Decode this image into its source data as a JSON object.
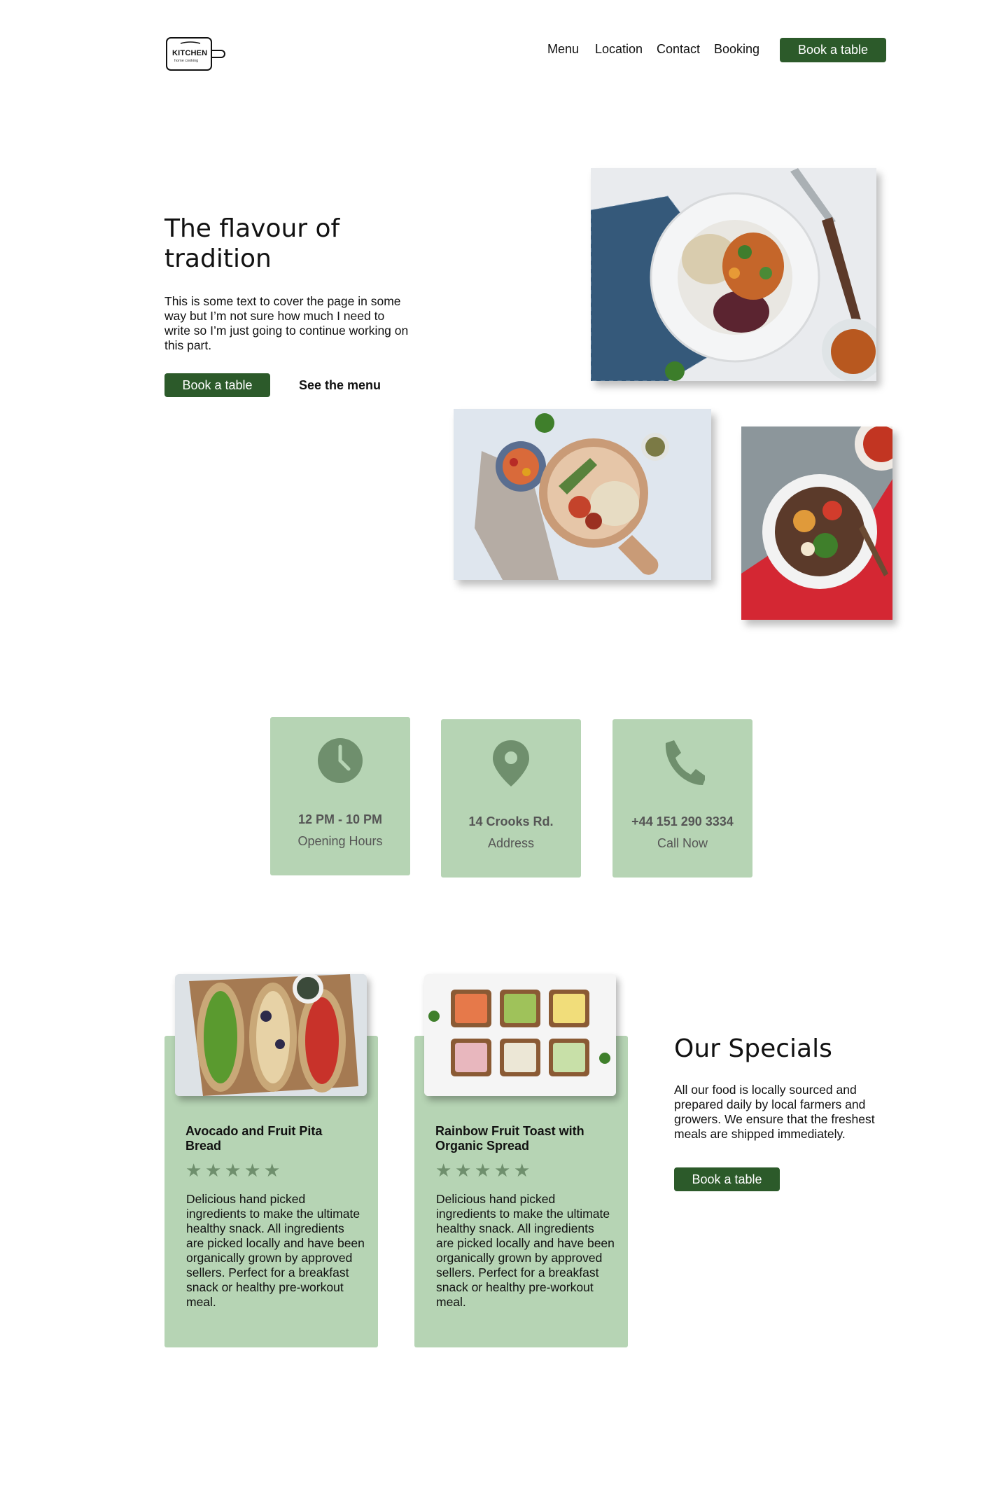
{
  "header": {
    "logo_text": "KITCHEN",
    "logo_sub": "home cooking",
    "nav": [
      "Menu",
      "Location",
      "Contact",
      "Booking"
    ],
    "cta": "Book a table"
  },
  "hero": {
    "title": "The flavour of tradition",
    "text": "This is some text to cover the page in some way but I’m not sure how much I need to write so I’m just going to continue working on this part.",
    "book": "Book a table",
    "menu": "See the menu"
  },
  "info": [
    {
      "icon": "clock-icon",
      "strong": "12 PM - 10 PM",
      "weak": "Opening Hours"
    },
    {
      "icon": "location-pin-icon",
      "strong": "14 Crooks Rd.",
      "weak": "Address"
    },
    {
      "icon": "phone-icon",
      "strong": "+44 151 290 3334",
      "weak": "Call Now"
    }
  ],
  "specials": {
    "title": "Our Specials",
    "text": "All our food is locally sourced and prepared daily by local farmers and growers. We ensure that the freshest meals are shipped immediately.",
    "book": "Book a table",
    "cards": [
      {
        "title": "Avocado and Fruit Pita Bread",
        "rating": 5,
        "text": "Delicious hand picked ingredients to make the ultimate healthy snack. All ingredients are picked locally and have been organically grown by approved sellers. Perfect for a breakfast snack or healthy pre-workout meal."
      },
      {
        "title": "Rainbow Fruit Toast with Organic Spread",
        "rating": 5,
        "text": "Delicious hand picked ingredients to make the ultimate healthy snack. All ingredients are picked locally and have been organically grown by approved sellers. Perfect for a breakfast snack or healthy pre-workout meal."
      }
    ]
  },
  "colors": {
    "brand_green": "#2c5a2a",
    "card_green": "#b6d4b4",
    "icon_green": "#6f8f6d"
  }
}
